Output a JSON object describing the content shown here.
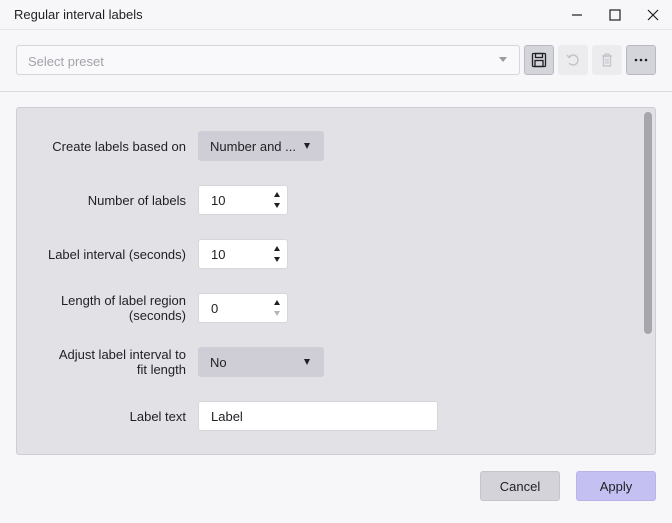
{
  "window": {
    "title": "Regular interval labels"
  },
  "preset": {
    "placeholder": "Select preset"
  },
  "form": {
    "create_labels": {
      "label": "Create labels based on",
      "value": "Number and ..."
    },
    "number_of_labels": {
      "label": "Number of labels",
      "value": "10"
    },
    "label_interval": {
      "label": "Label interval (seconds)",
      "value": "10"
    },
    "label_region_length": {
      "label_line1": "Length of label region",
      "label_line2": "(seconds)",
      "value": "0"
    },
    "adjust_interval": {
      "label_line1": "Adjust label interval to",
      "label_line2": "fit length",
      "value": "No"
    },
    "label_text": {
      "label": "Label text",
      "value": "Label"
    }
  },
  "footer": {
    "cancel_label": "Cancel",
    "apply_label": "Apply"
  },
  "icons": {
    "minimize": "minimize-icon",
    "maximize": "maximize-icon",
    "close": "close-icon",
    "save": "save-icon",
    "undo": "undo-icon",
    "delete": "trash-icon",
    "more": "more-icon"
  },
  "colors": {
    "apply_button": "#c4c0f1",
    "panel_background": "#e2e1e6",
    "dropdown_background": "#cfced6"
  }
}
